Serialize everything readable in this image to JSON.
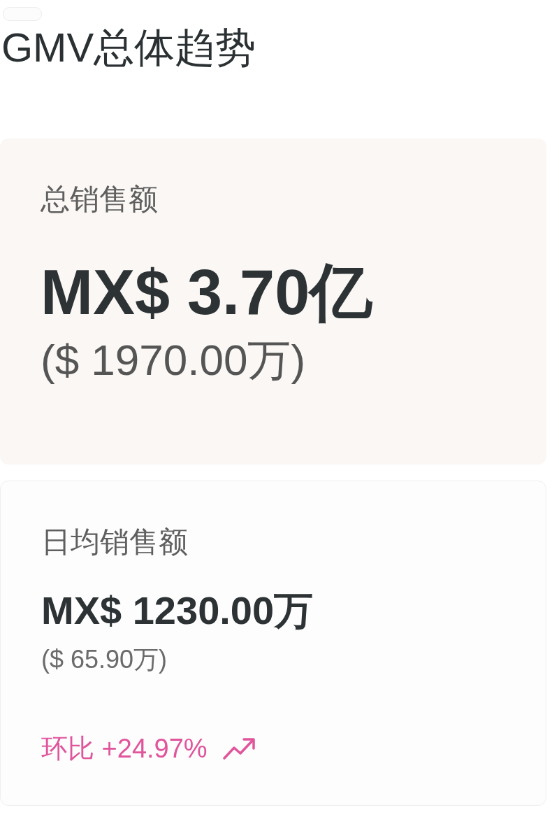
{
  "title": "GMV总体趋势",
  "cards": [
    {
      "kind": "highlight",
      "label": "总销售额",
      "value": "MX$ 3.70亿",
      "sub_value": "($ 1970.00万)"
    },
    {
      "kind": "plain",
      "label": "日均销售额",
      "value": "MX$ 1230.00万",
      "sub_value": "($ 65.90万)",
      "change": {
        "kind": "rise",
        "text": "环比 +24.97%"
      }
    }
  ]
}
